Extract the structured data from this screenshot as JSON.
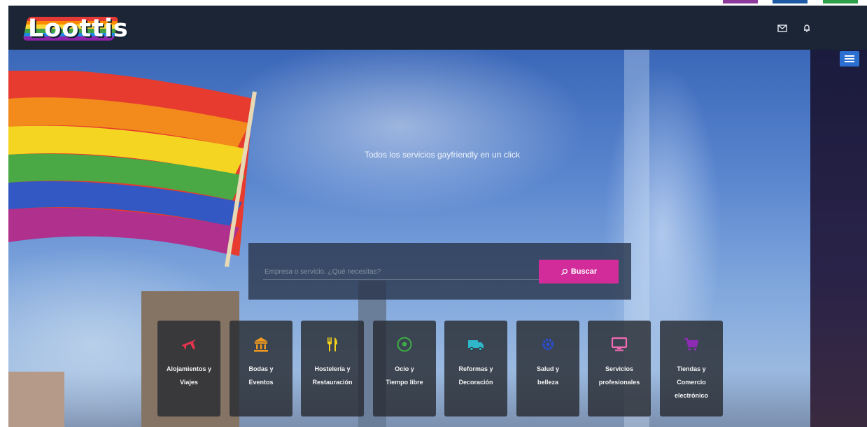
{
  "app": {
    "logo_text": "Loottis",
    "logo_stripes": [
      "#e53935",
      "#fb8c00",
      "#fdd835",
      "#43a047",
      "#1e88e5",
      "#8e24aa"
    ]
  },
  "top_swatches": [
    "#8e3a9d",
    "#1f5aa6",
    "#2fa14a"
  ],
  "navbar": {
    "icons": [
      "mail-icon",
      "bell-icon"
    ],
    "menu_icon": "hamburger-menu-icon"
  },
  "hero": {
    "tagline": "Todos los servicios gayfriendly en un click"
  },
  "search": {
    "placeholder": "Empresa o servicio. ¿Qué necesitas?",
    "button_label": "Buscar",
    "button_icon": "search-icon",
    "button_color": "#d12c9a"
  },
  "categories": [
    {
      "line1": "Alojamientos y",
      "line2": "Viajes",
      "line3": "",
      "icon": "airplane-icon",
      "color": "#e8344e"
    },
    {
      "line1": "Bodas y",
      "line2": "Eventos",
      "line3": "",
      "icon": "temple-icon",
      "color": "#f29a1d"
    },
    {
      "line1": "Hostelería y",
      "line2": "Restauración",
      "line3": "",
      "icon": "cutlery-icon",
      "color": "#f5d21b"
    },
    {
      "line1": "Ocio y",
      "line2": "Tiempo libre",
      "line3": "",
      "icon": "soccer-ball-icon",
      "color": "#3cb043"
    },
    {
      "line1": "Reformas y",
      "line2": "Decoración",
      "line3": "",
      "icon": "truck-icon",
      "color": "#2fb6c8"
    },
    {
      "line1": "Salud y",
      "line2": "belleza",
      "line3": "",
      "icon": "gear-icon",
      "color": "#2a4fd6"
    },
    {
      "line1": "Servicios",
      "line2": "profesionales",
      "line3": "",
      "icon": "monitor-icon",
      "color": "#f06ab4"
    },
    {
      "line1": "Tiendas y",
      "line2": "Comercio",
      "line3": "electrónico",
      "icon": "cart-icon",
      "color": "#8e2bb5"
    }
  ]
}
